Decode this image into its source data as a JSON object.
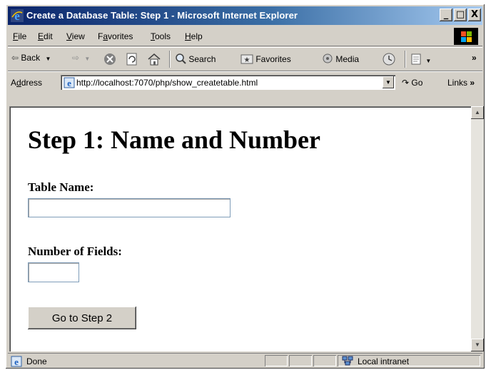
{
  "window": {
    "title": "Create a Database Table: Step 1 - Microsoft Internet Explorer",
    "minimize_label": "_",
    "maximize_label": "□",
    "close_label": "X"
  },
  "menubar": {
    "items": [
      {
        "prefix": "",
        "accel": "F",
        "rest": "ile"
      },
      {
        "prefix": "",
        "accel": "E",
        "rest": "dit"
      },
      {
        "prefix": "",
        "accel": "V",
        "rest": "iew"
      },
      {
        "prefix": "F",
        "accel": "a",
        "rest": "vorites"
      },
      {
        "prefix": "",
        "accel": "T",
        "rest": "ools"
      },
      {
        "prefix": "",
        "accel": "H",
        "rest": "elp"
      }
    ]
  },
  "toolbar": {
    "back_label": "Back",
    "search_label": "Search",
    "favorites_label": "Favorites",
    "media_label": "Media"
  },
  "address": {
    "label_prefix": "A",
    "label_accel": "d",
    "label_rest": "dress",
    "url": "http://localhost:7070/php/show_createtable.html",
    "go_label": "Go",
    "links_label": "Links"
  },
  "page": {
    "heading": "Step 1: Name and Number",
    "table_name_label": "Table Name:",
    "table_name_value": "",
    "number_of_fields_label": "Number of Fields:",
    "number_of_fields_value": "",
    "submit_label": "Go to Step 2"
  },
  "status": {
    "text": "Done",
    "zone": "Local intranet"
  },
  "colors": {
    "titlebar_start": "#0a246a",
    "titlebar_end": "#a6caf0",
    "chrome": "#d4d0c8"
  }
}
